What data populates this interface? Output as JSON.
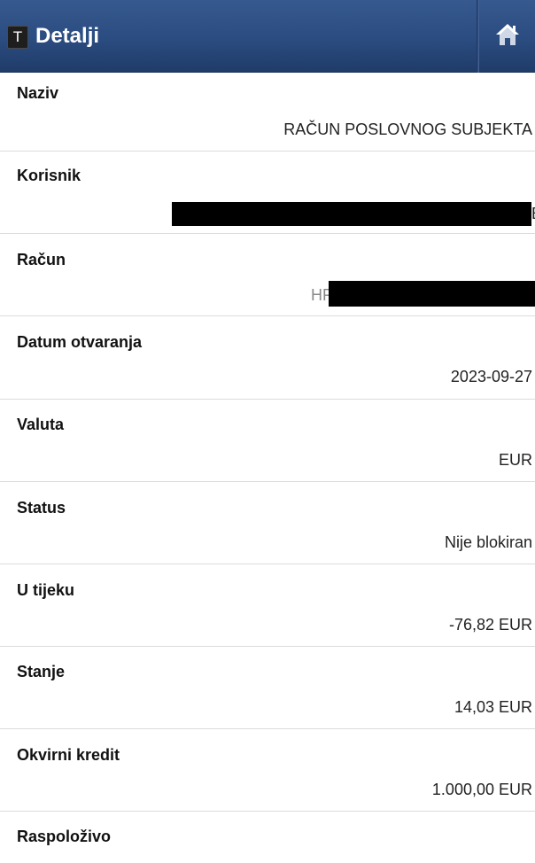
{
  "appbar": {
    "logo_letter": "T",
    "title": "Detalji",
    "home_icon": "home-icon"
  },
  "details": {
    "naziv": {
      "label": "Naziv",
      "value": "RAČUN POSLOVNOG SUBJEKTA"
    },
    "korisnik": {
      "label": "Korisnik",
      "value": "E"
    },
    "racun": {
      "label": "Račun",
      "value": "HR"
    },
    "datum": {
      "label": "Datum otvaranja",
      "value": "2023-09-27"
    },
    "valuta": {
      "label": "Valuta",
      "value": "EUR"
    },
    "status": {
      "label": "Status",
      "value": "Nije blokiran"
    },
    "u_tijeku": {
      "label": "U tijeku",
      "value": "-76,82 EUR"
    },
    "stanje": {
      "label": "Stanje",
      "value": "14,03 EUR"
    },
    "okvirni": {
      "label": "Okvirni kredit",
      "value": "1.000,00 EUR"
    },
    "raspolozivo": {
      "label": "Raspoloživo",
      "value": ""
    }
  },
  "colors": {
    "appbar": "#2b4c80",
    "redaction": "#000000"
  }
}
